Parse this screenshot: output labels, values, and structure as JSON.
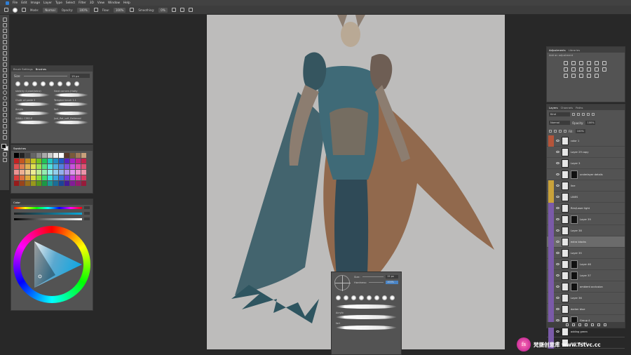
{
  "menu": [
    "File",
    "Edit",
    "Image",
    "Layer",
    "Type",
    "Select",
    "Filter",
    "3D",
    "View",
    "Window",
    "Help"
  ],
  "options": {
    "mode_label": "Mode:",
    "mode_value": "Normal",
    "opacity_label": "Opacity:",
    "opacity_value": "100%",
    "flow_label": "Flow:",
    "flow_value": "100%",
    "smoothing_label": "Smoothing:",
    "smoothing_value": "0%"
  },
  "brush_panel": {
    "tabs": [
      "Brush Settings",
      "Brushes"
    ],
    "size_label": "Size:",
    "size_value": "15 px",
    "brushes": [
      {
        "name": "sketchy 4 pixel(brkrz)"
      },
      {
        "name": "Hard corners (Hatty"
      },
      {
        "name": "Chalk oil paste 2"
      },
      {
        "name": "Tempted brush 1.1"
      },
      {
        "name": "Acrylic"
      },
      {
        "name": "fart"
      },
      {
        "name": "SMALL CIRCLE"
      },
      {
        "name": "Just_flat_soft_flattened"
      }
    ]
  },
  "swatches_panel": {
    "title": "Swatches"
  },
  "color_panel": {
    "title": "Color"
  },
  "adjustments_panel": {
    "tabs": [
      "Adjustments",
      "Libraries"
    ],
    "hint": "Add an adjustment"
  },
  "layers_panel": {
    "tabs": [
      "Layers",
      "Channels",
      "Paths"
    ],
    "kind_label": "Kind",
    "blend_mode": "Normal",
    "opacity_label": "Opacity:",
    "opacity_value": "100%",
    "fill_label": "Fill:",
    "fill_value": "100%",
    "layers": [
      {
        "name": "color 1",
        "tag": "#b5553a",
        "mask": false,
        "selected": false
      },
      {
        "name": "Layer 29 copy",
        "tag": "",
        "mask": false,
        "selected": false
      },
      {
        "name": "Layer 3",
        "tag": "",
        "mask": false,
        "selected": false
      },
      {
        "name": "underlayer details",
        "tag": "",
        "mask": true,
        "selected": false
      },
      {
        "name": "line",
        "tag": "#c9a23a",
        "mask": false,
        "selected": false
      },
      {
        "name": "LINES",
        "tag": "#c9a23a",
        "mask": false,
        "selected": false
      },
      {
        "name": "Rim/Laser light",
        "tag": "#7a5aa8",
        "mask": false,
        "selected": false
      },
      {
        "name": "Layer 39",
        "tag": "#7a5aa8",
        "mask": true,
        "selected": false
      },
      {
        "name": "Layer 38",
        "tag": "#7a5aa8",
        "mask": false,
        "selected": false
      },
      {
        "name": "extra blacks",
        "tag": "#7a5aa8",
        "mask": false,
        "selected": true
      },
      {
        "name": "Layer 35",
        "tag": "#7a5aa8",
        "mask": false,
        "selected": false
      },
      {
        "name": "Layer 46",
        "tag": "#7a5aa8",
        "mask": true,
        "selected": false
      },
      {
        "name": "Layer 37",
        "tag": "#7a5aa8",
        "mask": true,
        "selected": false
      },
      {
        "name": "ambient occlusion",
        "tag": "#7a5aa8",
        "mask": true,
        "selected": false
      },
      {
        "name": "Layer 36",
        "tag": "#7a5aa8",
        "mask": false,
        "selected": false
      },
      {
        "name": "darker blue",
        "tag": "#7a5aa8",
        "mask": false,
        "selected": false
      },
      {
        "name": "Group 4",
        "tag": "#7a5aa8",
        "mask": true,
        "selected": false
      },
      {
        "name": "adding green",
        "tag": "#7a5aa8",
        "mask": false,
        "selected": false
      },
      {
        "name": "pushing light",
        "tag": "#7a5aa8",
        "mask": false,
        "selected": false
      }
    ]
  },
  "brush_popup": {
    "size_label": "Size:",
    "size_value": "15 px",
    "hardness_label": "Hardness:",
    "hardness_value": "100%",
    "strokes": [
      {
        "name": "Acrylic"
      },
      {
        "name": "fart"
      }
    ]
  },
  "watermark": {
    "logo": "fs",
    "text": "梵摄创意库 www.fstvc.cc"
  }
}
